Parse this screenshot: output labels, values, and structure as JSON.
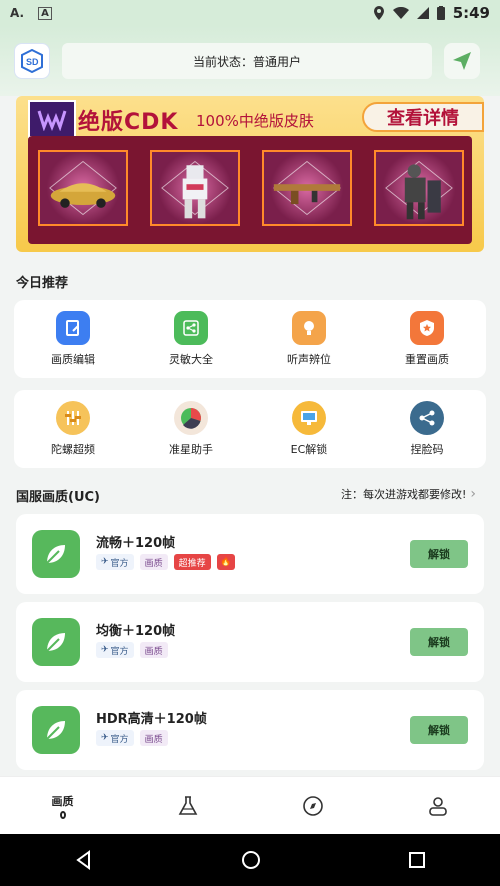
{
  "status_bar": {
    "time": "5:49"
  },
  "header": {
    "status_text": "当前状态：普通用户"
  },
  "banner": {
    "title": "绝版CDK",
    "subtitle": "100%中绝版皮肤",
    "more_label": "查看详情",
    "skins": [
      "car",
      "robot",
      "rifle",
      "outfit"
    ]
  },
  "recommend": {
    "title": "今日推荐",
    "row1": [
      {
        "label": "画质编辑",
        "icon": "edit-icon",
        "color": "#3d7ef1"
      },
      {
        "label": "灵敏大全",
        "icon": "share-icon",
        "color": "#4cbb5a"
      },
      {
        "label": "听声辨位",
        "icon": "bulb-icon",
        "color": "#f4a44a"
      },
      {
        "label": "重置画质",
        "icon": "shield-star-icon",
        "color": "#f3773a"
      }
    ],
    "row2": [
      {
        "label": "陀螺超频",
        "icon": "sliders-icon",
        "color": "#f6c35a"
      },
      {
        "label": "准星助手",
        "icon": "pie-icon",
        "color": "#e84a4a"
      },
      {
        "label": "EC解锁",
        "icon": "monitor-icon",
        "color": "#f6b93a"
      },
      {
        "label": "捏脸码",
        "icon": "share-node-icon",
        "color": "#3b6b8e"
      }
    ]
  },
  "quality": {
    "title": "国服画质(UC)",
    "note": "注：每次进游戏都要修改!",
    "presets": [
      {
        "name": "流畅＋120帧",
        "tags": [
          "官方",
          "画质",
          "超推荐"
        ],
        "hot": true,
        "button": "解锁"
      },
      {
        "name": "均衡＋120帧",
        "tags": [
          "官方",
          "画质"
        ],
        "hot": false,
        "button": "解锁"
      },
      {
        "name": "HDR高清＋120帧",
        "tags": [
          "官方",
          "画质"
        ],
        "hot": false,
        "button": "解锁"
      }
    ]
  },
  "bottom_nav": {
    "items": [
      {
        "label": "画质",
        "icon": "quality-icon"
      },
      {
        "label": "",
        "icon": "flask-icon"
      },
      {
        "label": "",
        "icon": "compass-icon"
      },
      {
        "label": "",
        "icon": "user-icon"
      }
    ]
  }
}
